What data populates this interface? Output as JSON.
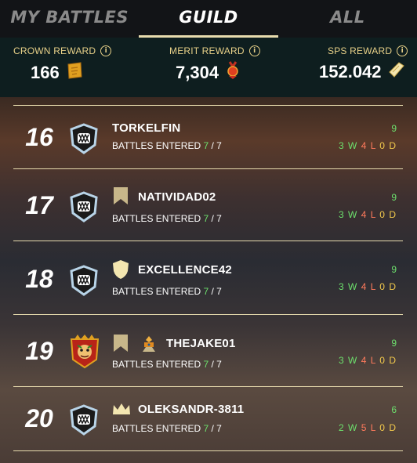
{
  "tabs": [
    {
      "label": "MY BATTLES"
    },
    {
      "label": "GUILD"
    },
    {
      "label": "ALL"
    }
  ],
  "rewards": {
    "crown": {
      "label": "CROWN REWARD",
      "value": "166"
    },
    "merit": {
      "label": "MERIT REWARD",
      "value": "7,304"
    },
    "sps": {
      "label": "SPS REWARD",
      "value": "152.042"
    }
  },
  "info_glyph": "i",
  "battles_label": "BATTLES ENTERED",
  "rows": [
    {
      "rank": "16",
      "name": "TORKELFIN",
      "entered": "7",
      "total": "/ 7",
      "wins": "9",
      "w": "3",
      "l": "4",
      "d": "0"
    },
    {
      "rank": "17",
      "name": "NATIVIDAD02",
      "entered": "7",
      "total": "/ 7",
      "wins": "9",
      "w": "3",
      "l": "4",
      "d": "0"
    },
    {
      "rank": "18",
      "name": "EXCELLENCE42",
      "entered": "7",
      "total": "/ 7",
      "wins": "9",
      "w": "3",
      "l": "4",
      "d": "0"
    },
    {
      "rank": "19",
      "name": "THEJAKE01",
      "entered": "7",
      "total": "/ 7",
      "wins": "9",
      "w": "3",
      "l": "4",
      "d": "0"
    },
    {
      "rank": "20",
      "name": "OLEKSANDR-3811",
      "entered": "7",
      "total": "/ 7",
      "wins": "6",
      "w": "2",
      "l": "5",
      "d": "0"
    }
  ],
  "record_letters": {
    "w": "W",
    "l": "L",
    "d": "D"
  }
}
